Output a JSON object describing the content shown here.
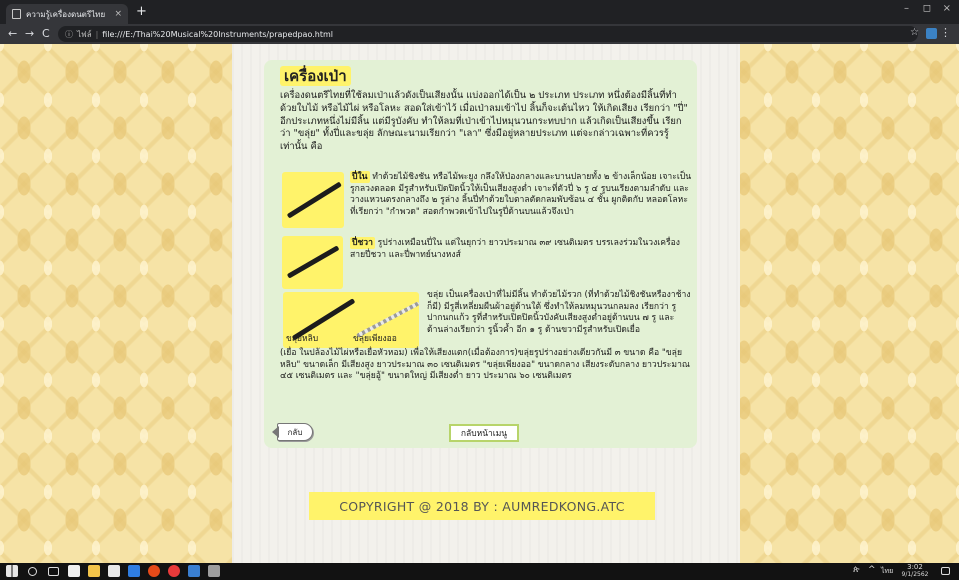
{
  "browser": {
    "tab_title": "ความรู้เครื่องดนตรีไทย",
    "new_tab": "+",
    "tab_close": "×",
    "window_controls": {
      "minimize": "–",
      "maximize": "◻",
      "close": "×"
    },
    "nav": {
      "back": "←",
      "forward": "→",
      "reload": "C"
    },
    "address_info": "ⓘ",
    "address_security": "ไฟล์",
    "address_separator": "|",
    "url": "file:///E:/Thai%20Musical%20Instruments/prapedpao.html",
    "star": "☆",
    "menu": "⋮"
  },
  "page": {
    "heading": "เครื่องเป่า",
    "intro": "เครื่องดนตรีไทยที่ใช้ลมเป่าแล้วดังเป็นเสียงนั้น แบ่งออกได้เป็น ๒ ประเภท ประเภท หนึ่งต้องมีลิ้นที่ทำด้วยใบไม้ หรือไม้ไผ่ หรือโลหะ สอดใส่เข้าไว้ เมื่อเป่าลมเข้าไป ลิ้นก็จะเต้นไหว ให้เกิดเสียง เรียกว่า \"ปี่\" อีกประเภทหนึ่งไม่มีลิ้น แต่มีรูบังคับ ทำให้ลมที่เป่าเข้าไปหมุนวนกระทบปาก แล้วเกิดเป็นเสียงขึ้น เรียกว่า \"ขลุ่ย\" ทั้งปี่และขลุ่ย ลักษณะนามเรียกว่า \"เลา\" ซึ่งมีอยู่หลายประเภท แต่จะกล่าวเฉพาะที่ควรรู้เท่านั้น คือ",
    "items": [
      {
        "name": "ปี่ใน",
        "text": " ทำด้วยไม้ชิงชัน หรือไม้พะยูง กลึงให้ป่องกลางและบานปลายทั้ง ๒ ข้างเล็กน้อย เจาะเป็นรูกลวงตลอด มีรูสำหรับเปิดปิดนิ้วให้เป็นเสียงสูงต่ำ เจาะที่ตัวปี่ ๖ รู ๔ รูบนเรียงตามลำดับ และวางแหวนตรงกลางถึง ๒ รูล่าง ลิ้นปี่ทำด้วยใบตาลตัดกลมพับซ้อน ๔ ชั้น ผูกติดกับ หลอดโลหะที่เรียกว่า \"กำพวด\" สอดกำพวดเข้าไปในรูปี่ด้านบนแล้วจึงเป่า"
      },
      {
        "name": "ปี่ชวา",
        "text": " รูปร่างเหมือนปี่ใน แต่ในยุกว่า ยาวประมาณ ๓๙ เซนติเมตร บรรเลงร่วมในวงเครื่องสายปี่ชวา และปี่พาทย์นางหงส์"
      },
      {
        "name": "ขลุ่ย",
        "text": " เป็นเครื่องเป่าที่ไม่มีลิ้น ทำด้วยไม้รวก (ที่ทำด้วยไม้ชิงชันหรืองาช้างก็มี) มีรูสี่เหลี่ยมผืนผ้าอยู่ด้านใต้ ซึ่งทำให้ลมหมุนวนกลมลง เรียกว่า รูปากนกแก้ว รูที่สำหรับเปิดปิดนิ้วบังคับเสียงสูงต่ำอยู่ด้านบน ๗ รู และ ด้านล่างเรียกว่า รูนิ้วค้ำ อีก ๑ รู ด้านขวามีรูสำหรับเปิดเยื่อ"
      }
    ],
    "khlui_continued": "(เยื่อ ในปล้องไม้ไผ่หรือเยื่อหัวหอม) เพื่อให้เสียงแตก(เมื่อต้องการ)ขลุ่ยรูปร่างอย่างเดียวกันมี ๓ ขนาด คือ \"ขลุ่ยหลิบ\" ขนาดเล็ก มีเสียงสูง ยาวประมาณ ๓๐ เซนติเมตร \"ขลุ่ยเพียงออ\" ขนาดกลาง เสียงระดับกลาง ยาวประมาณ ๔๕ เซนติเมตร และ \"ขลุ่ยอู้\" ขนาดใหญ่ มีเสียงต่ำ ยาว ประมาณ ๖๐ เซนติเมตร",
    "image_labels": {
      "khlui_lip": "ขลุ่ยหลิบ",
      "khlui_phiang_o": "ขลุ่ยเพียงออ"
    },
    "back_button": "กลับ",
    "menu_button": "กลับหน้าเมนู",
    "copyright": "COPYRIGHT @ 2018 BY : AUMREDKONG.ATC"
  },
  "taskbar": {
    "time": "3:02",
    "date": "9/1/2562",
    "lang": "ไทย",
    "tray": "^",
    "people": "ጵ"
  },
  "colors": {
    "highlight": "#fff36a",
    "card": "#e3f1d5",
    "wallpaper": "#f6e3a6"
  }
}
